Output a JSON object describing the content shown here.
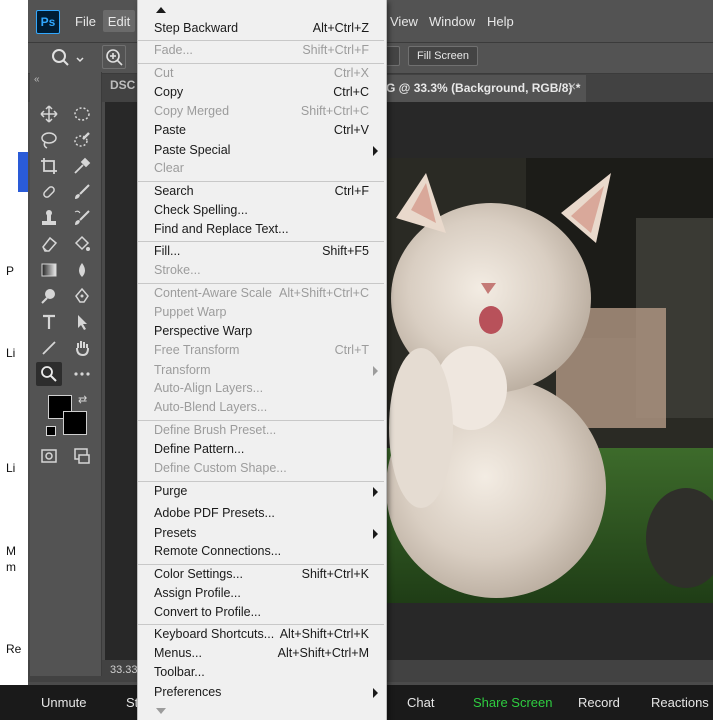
{
  "app": {
    "logo_text": "Ps",
    "menu": [
      "File",
      "Edit",
      "View",
      "Window",
      "Help"
    ]
  },
  "options_bar": {
    "fill_screen_label": "Fill Screen"
  },
  "tabs": {
    "left_tab_fragment": "DSC",
    "active_tab_title": "G @ 33.3% (Background, RGB/8) *"
  },
  "status_bar": {
    "zoom": "33.33"
  },
  "left_strip_fragments": [
    "P",
    "Li",
    "Li",
    "M",
    "m",
    "Re"
  ],
  "edit_menu": [
    {
      "label": "Step Backward",
      "shortcut": "Alt+Ctrl+Z",
      "enabled": true
    },
    {
      "label": "Fade...",
      "shortcut": "Shift+Ctrl+F",
      "enabled": false
    },
    {
      "label": "Cut",
      "shortcut": "Ctrl+X",
      "enabled": false
    },
    {
      "label": "Copy",
      "shortcut": "Ctrl+C",
      "enabled": true
    },
    {
      "label": "Copy Merged",
      "shortcut": "Shift+Ctrl+C",
      "enabled": false
    },
    {
      "label": "Paste",
      "shortcut": "Ctrl+V",
      "enabled": true
    },
    {
      "label": "Paste Special",
      "shortcut": "",
      "enabled": true,
      "submenu": true
    },
    {
      "label": "Clear",
      "shortcut": "",
      "enabled": false
    },
    {
      "label": "Search",
      "shortcut": "Ctrl+F",
      "enabled": true
    },
    {
      "label": "Check Spelling...",
      "shortcut": "",
      "enabled": true
    },
    {
      "label": "Find and Replace Text...",
      "shortcut": "",
      "enabled": true
    },
    {
      "label": "Fill...",
      "shortcut": "Shift+F5",
      "enabled": true
    },
    {
      "label": "Stroke...",
      "shortcut": "",
      "enabled": false
    },
    {
      "label": "Content-Aware Scale",
      "shortcut": "Alt+Shift+Ctrl+C",
      "enabled": false
    },
    {
      "label": "Puppet Warp",
      "shortcut": "",
      "enabled": false
    },
    {
      "label": "Perspective Warp",
      "shortcut": "",
      "enabled": true
    },
    {
      "label": "Free Transform",
      "shortcut": "Ctrl+T",
      "enabled": false
    },
    {
      "label": "Transform",
      "shortcut": "",
      "enabled": false,
      "submenu": true
    },
    {
      "label": "Auto-Align Layers...",
      "shortcut": "",
      "enabled": false
    },
    {
      "label": "Auto-Blend Layers...",
      "shortcut": "",
      "enabled": false
    },
    {
      "label": "Define Brush Preset...",
      "shortcut": "",
      "enabled": false
    },
    {
      "label": "Define Pattern...",
      "shortcut": "",
      "enabled": true
    },
    {
      "label": "Define Custom Shape...",
      "shortcut": "",
      "enabled": false
    },
    {
      "label": "Purge",
      "shortcut": "",
      "enabled": true,
      "submenu": true
    },
    {
      "label": "Adobe PDF Presets...",
      "shortcut": "",
      "enabled": true
    },
    {
      "label": "Presets",
      "shortcut": "",
      "enabled": true,
      "submenu": true
    },
    {
      "label": "Remote Connections...",
      "shortcut": "",
      "enabled": true
    },
    {
      "label": "Color Settings...",
      "shortcut": "Shift+Ctrl+K",
      "enabled": true
    },
    {
      "label": "Assign Profile...",
      "shortcut": "",
      "enabled": true
    },
    {
      "label": "Convert to Profile...",
      "shortcut": "",
      "enabled": true
    },
    {
      "label": "Keyboard Shortcuts...",
      "shortcut": "Alt+Shift+Ctrl+K",
      "enabled": true
    },
    {
      "label": "Menus...",
      "shortcut": "Alt+Shift+Ctrl+M",
      "enabled": true
    },
    {
      "label": "Toolbar...",
      "shortcut": "",
      "enabled": true
    },
    {
      "label": "Preferences",
      "shortcut": "",
      "enabled": true,
      "submenu": true
    }
  ],
  "zoom_bar": {
    "unmute": "Unmute",
    "start_video_fragment": "St",
    "chat": "Chat",
    "share_screen": "Share Screen",
    "record": "Record",
    "reactions": "Reactions",
    "share_color": "#2ecc40"
  },
  "colors": {
    "ps_accent": "#31a8ff",
    "menu_disabled": "#9c9c9c",
    "foreground_swatch": "#000000",
    "background_swatch": "#000000"
  }
}
